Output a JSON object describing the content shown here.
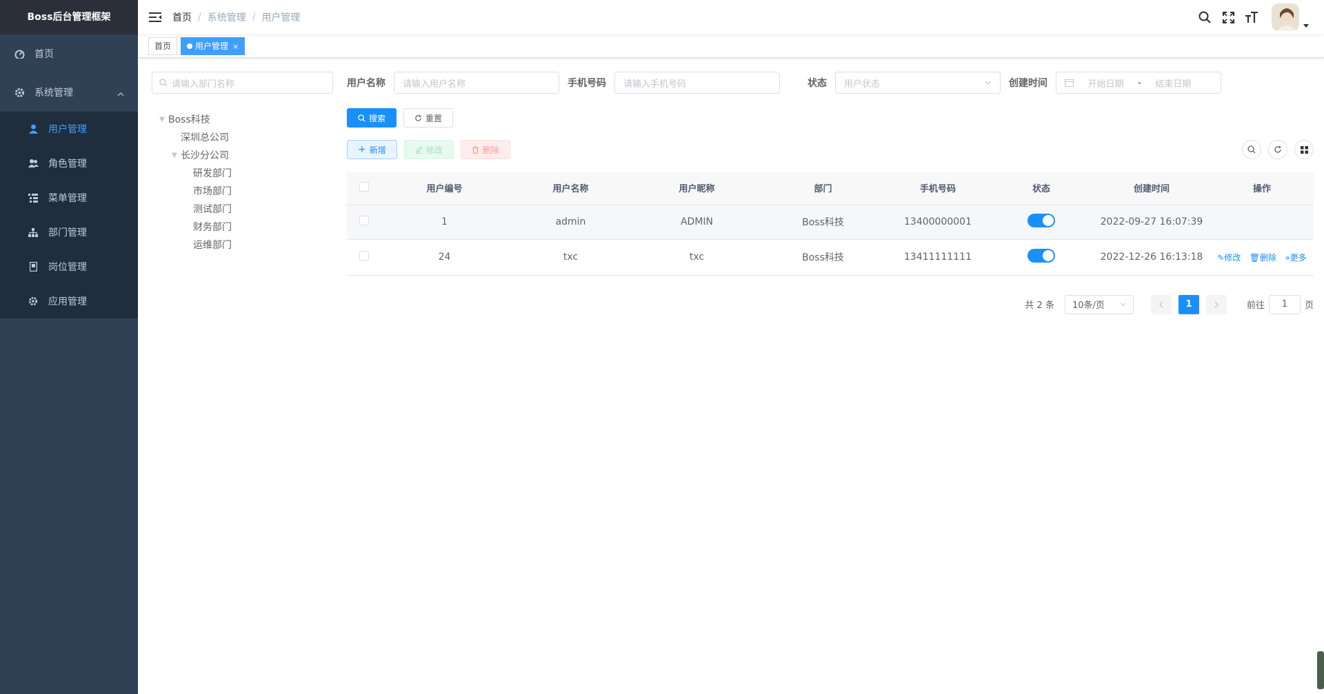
{
  "app": {
    "title": "Boss后台管理框架"
  },
  "sidebar": {
    "items": [
      {
        "label": "首页"
      },
      {
        "label": "系统管理"
      }
    ],
    "submenu": [
      {
        "label": "用户管理"
      },
      {
        "label": "角色管理"
      },
      {
        "label": "菜单管理"
      },
      {
        "label": "部门管理"
      },
      {
        "label": "岗位管理"
      },
      {
        "label": "应用管理"
      }
    ]
  },
  "header": {
    "breadcrumb": [
      "首页",
      "系统管理",
      "用户管理"
    ],
    "separator": "/"
  },
  "tags": [
    {
      "label": "首页"
    },
    {
      "label": "用户管理",
      "close": "×"
    }
  ],
  "dept": {
    "search_placeholder": "请输入部门名称",
    "tree": {
      "root": "Boss科技",
      "children": [
        "深圳总公司",
        "长沙分公司"
      ],
      "grandchildren": [
        "研发部门",
        "市场部门",
        "测试部门",
        "财务部门",
        "运维部门"
      ]
    }
  },
  "search": {
    "username_label": "用户名称",
    "username_placeholder": "请输入用户名称",
    "phone_label": "手机号码",
    "phone_placeholder": "请输入手机号码",
    "status_label": "状态",
    "status_placeholder": "用户状态",
    "created_label": "创建时间",
    "start_placeholder": "开始日期",
    "range_sep": "-",
    "end_placeholder": "结束日期",
    "search_btn": "搜索",
    "reset_btn": "重置"
  },
  "toolbar": {
    "add": "新增",
    "edit": "修改",
    "delete": "删除"
  },
  "table": {
    "columns": [
      "用户编号",
      "用户名称",
      "用户昵称",
      "部门",
      "手机号码",
      "状态",
      "创建时间",
      "操作"
    ],
    "rows": [
      {
        "id": "1",
        "username": "admin",
        "nickname": "ADMIN",
        "dept": "Boss科技",
        "phone": "13400000001",
        "status": true,
        "created": "2022-09-27 16:07:39",
        "ops": []
      },
      {
        "id": "24",
        "username": "txc",
        "nickname": "txc",
        "dept": "Boss科技",
        "phone": "13411111111",
        "status": true,
        "created": "2022-12-26 16:13:18",
        "ops": [
          "修改",
          "删除",
          "更多"
        ]
      }
    ]
  },
  "pagination": {
    "total": "共 2 条",
    "page_size": "10条/页",
    "current": "1",
    "goto_label": "前往",
    "goto_value": "1",
    "goto_suffix": "页"
  },
  "colors": {
    "sidebar": "#304156",
    "primary": "#1890ff",
    "submenu": "#1f2d3d"
  }
}
